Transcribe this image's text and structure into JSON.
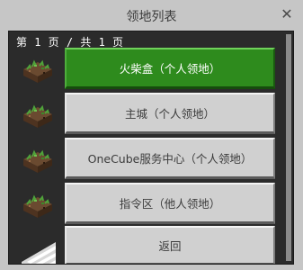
{
  "window": {
    "title": "领地列表",
    "close_glyph": "✕"
  },
  "pager": {
    "text": "第 1 页 / 共 1 页"
  },
  "lands": [
    {
      "label": "火柴盒（个人领地）",
      "selected": true,
      "icon": "grass-block-icon"
    },
    {
      "label": "主城（个人领地）",
      "selected": false,
      "icon": "grass-block-icon"
    },
    {
      "label": "OneCube服务中心（个人领地）",
      "selected": false,
      "icon": "grass-block-icon"
    },
    {
      "label": "指令区（他人领地）",
      "selected": false,
      "icon": "grass-block-icon"
    }
  ],
  "back": {
    "label": "返回",
    "icon": "back-arrow-icon"
  },
  "colors": {
    "selected_button": "#2e8b1d",
    "button": "#d0d0d0",
    "panel_bg": "#2b2b2b",
    "window_bg": "#c6c6c6"
  }
}
